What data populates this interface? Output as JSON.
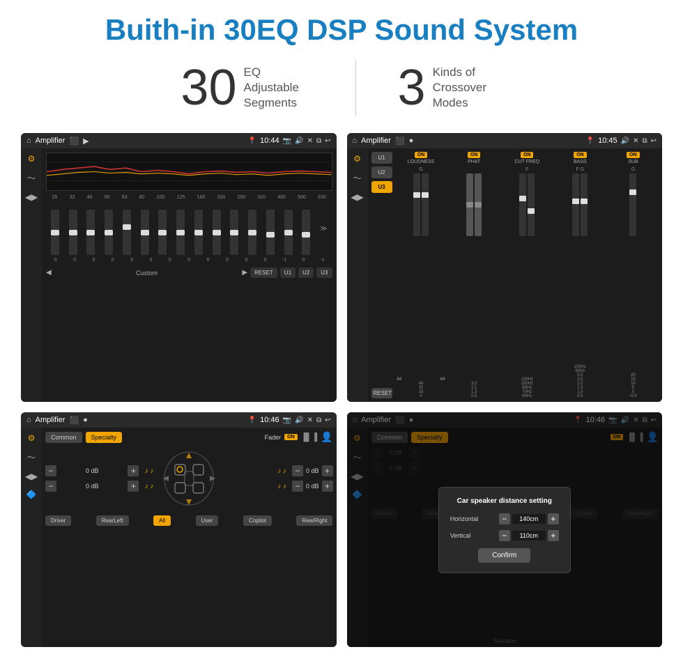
{
  "page": {
    "title": "Buith-in 30EQ DSP Sound System",
    "stat1_number": "30",
    "stat1_label_line1": "EQ Adjustable",
    "stat1_label_line2": "Segments",
    "stat2_number": "3",
    "stat2_label_line1": "Kinds of",
    "stat2_label_line2": "Crossover Modes"
  },
  "screen1": {
    "app_name": "Amplifier",
    "time": "10:44",
    "freq_labels": [
      "25",
      "32",
      "40",
      "50",
      "63",
      "80",
      "100",
      "125",
      "160",
      "200",
      "250",
      "320",
      "400",
      "500",
      "630"
    ],
    "slider_values": [
      "0",
      "0",
      "0",
      "0",
      "5",
      "0",
      "0",
      "0",
      "0",
      "0",
      "0",
      "0",
      "-1",
      "0",
      "-1"
    ],
    "bottom_label": "Custom",
    "btn_reset": "RESET",
    "btn_u1": "U1",
    "btn_u2": "U2",
    "btn_u3": "U3"
  },
  "screen2": {
    "app_name": "Amplifier",
    "time": "10:45",
    "presets": [
      "U1",
      "U2",
      "U3"
    ],
    "active_preset": "U3",
    "reset_label": "RESET",
    "bands": [
      {
        "on": true,
        "name": "LOUDNESS"
      },
      {
        "on": true,
        "name": "PHAT"
      },
      {
        "on": true,
        "name": "CUT FREQ"
      },
      {
        "on": true,
        "name": "BASS"
      },
      {
        "on": true,
        "name": "SUB"
      }
    ],
    "on_label": "ON"
  },
  "screen3": {
    "app_name": "Amplifier",
    "time": "10:46",
    "tab_common": "Common",
    "tab_specialty": "Specialty",
    "fader_label": "Fader",
    "on_label": "ON",
    "db_values": [
      "0 dB",
      "0 dB",
      "0 dB",
      "0 dB"
    ],
    "btn_driver": "Driver",
    "btn_rear_left": "RearLeft",
    "btn_all": "All",
    "btn_user": "User",
    "btn_copilot": "Copilot",
    "btn_rear_right": "RearRight"
  },
  "screen4": {
    "app_name": "Amplifier",
    "time": "10:46",
    "tab_common": "Common",
    "tab_specialty": "Specialty",
    "on_label": "ON",
    "dialog": {
      "title": "Car speaker distance setting",
      "horizontal_label": "Horizontal",
      "horizontal_value": "140cm",
      "vertical_label": "Vertical",
      "vertical_value": "110cm",
      "confirm_label": "Confirm"
    },
    "db_values": [
      "0 dB",
      "0 dB"
    ],
    "btn_driver": "Driver",
    "btn_rear_left": "RearLef...",
    "btn_all": "All",
    "btn_user": "User",
    "btn_copilot": "Copilot",
    "btn_rear_right": "RearRight"
  },
  "watermark": "Seicane"
}
